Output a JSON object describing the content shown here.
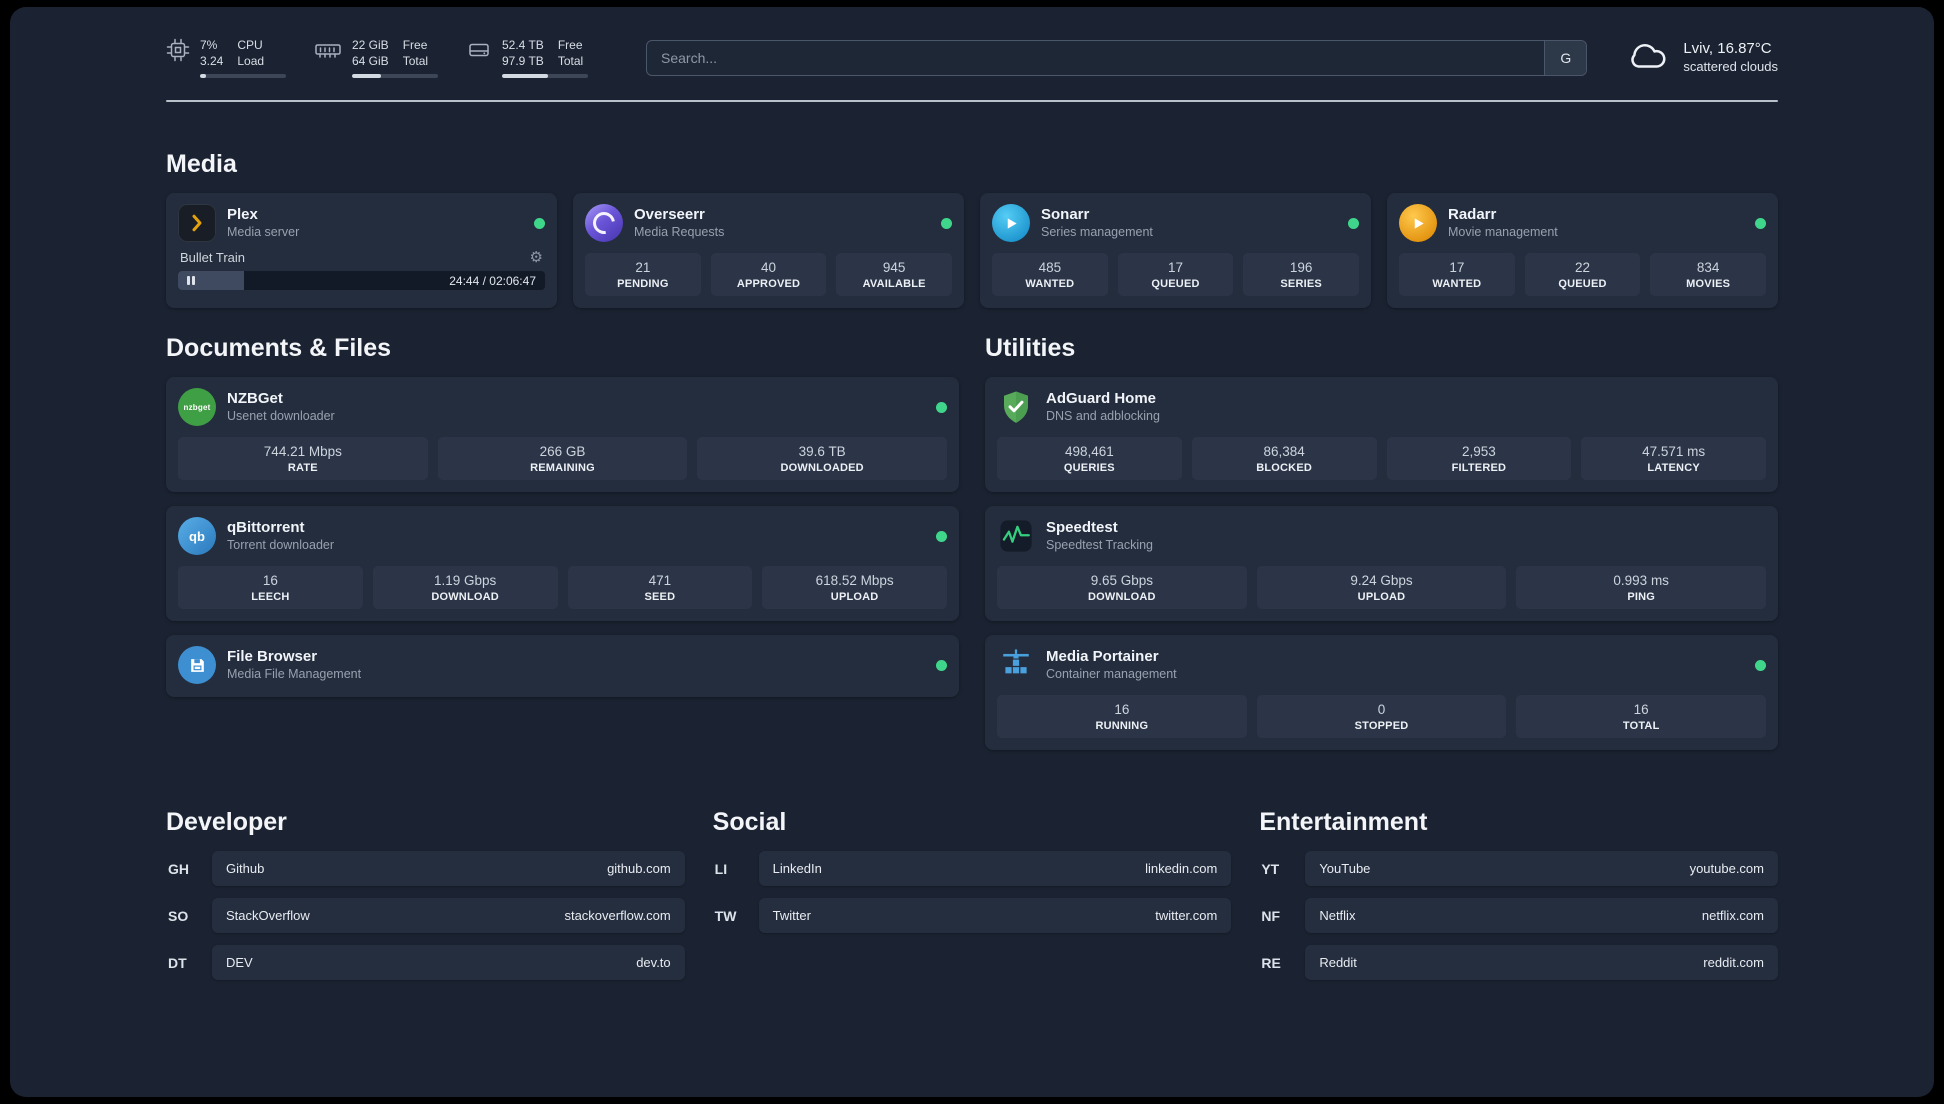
{
  "colors": {
    "background": "#1b2332",
    "card": "#242d3d",
    "tile": "#2b3547",
    "status_online": "#3fd68c",
    "accent_green": "#35d07f",
    "plex_amber": "#e5a00d"
  },
  "icons": {
    "gear": "⚙"
  },
  "topbar": {
    "cpu": {
      "top_value": "7%",
      "bottom_value": "3.24",
      "top_label": "CPU",
      "bottom_label": "Load",
      "progress": 7
    },
    "memory": {
      "top_value": "22 GiB",
      "bottom_value": "64 GiB",
      "top_label": "Free",
      "bottom_label": "Total",
      "progress": 34
    },
    "disk": {
      "top_value": "52.4 TB",
      "bottom_value": "97.9 TB",
      "top_label": "Free",
      "bottom_label": "Total",
      "progress": 54
    },
    "search": {
      "placeholder": "Search...",
      "button_label": "G"
    },
    "weather": {
      "line1": "Lviv, 16.87°C",
      "line2": "scattered clouds"
    }
  },
  "titles": {
    "media": "Media",
    "documents": "Documents & Files",
    "utilities": "Utilities"
  },
  "apps": {
    "plex": {
      "name": "Plex",
      "desc": "Media server",
      "player": {
        "title": "Bullet Train",
        "time": "24:44 / 02:06:47",
        "progress": 18
      }
    },
    "overseerr": {
      "name": "Overseerr",
      "desc": "Media Requests",
      "stats": [
        {
          "value": "21",
          "label": "PENDING"
        },
        {
          "value": "40",
          "label": "APPROVED"
        },
        {
          "value": "945",
          "label": "AVAILABLE"
        }
      ]
    },
    "sonarr": {
      "name": "Sonarr",
      "desc": "Series management",
      "stats": [
        {
          "value": "485",
          "label": "WANTED"
        },
        {
          "value": "17",
          "label": "QUEUED"
        },
        {
          "value": "196",
          "label": "SERIES"
        }
      ]
    },
    "radarr": {
      "name": "Radarr",
      "desc": "Movie management",
      "stats": [
        {
          "value": "17",
          "label": "WANTED"
        },
        {
          "value": "22",
          "label": "QUEUED"
        },
        {
          "value": "834",
          "label": "MOVIES"
        }
      ]
    },
    "nzbget": {
      "name": "NZBGet",
      "desc": "Usenet downloader",
      "icon_text": "nzbget",
      "stats": [
        {
          "value": "744.21 Mbps",
          "label": "RATE"
        },
        {
          "value": "266 GB",
          "label": "REMAINING"
        },
        {
          "value": "39.6 TB",
          "label": "DOWNLOADED"
        }
      ]
    },
    "qbittorrent": {
      "name": "qBittorrent",
      "desc": "Torrent downloader",
      "icon_text": "qb",
      "stats": [
        {
          "value": "16",
          "label": "LEECH"
        },
        {
          "value": "1.19 Gbps",
          "label": "DOWNLOAD"
        },
        {
          "value": "471",
          "label": "SEED"
        },
        {
          "value": "618.52 Mbps",
          "label": "UPLOAD"
        }
      ]
    },
    "filebrowser": {
      "name": "File Browser",
      "desc": "Media File Management"
    },
    "adguard": {
      "name": "AdGuard Home",
      "desc": "DNS and adblocking",
      "stats": [
        {
          "value": "498,461",
          "label": "QUERIES"
        },
        {
          "value": "86,384",
          "label": "BLOCKED"
        },
        {
          "value": "2,953",
          "label": "FILTERED"
        },
        {
          "value": "47.571 ms",
          "label": "LATENCY"
        }
      ]
    },
    "speedtest": {
      "name": "Speedtest",
      "desc": "Speedtest Tracking",
      "stats": [
        {
          "value": "9.65 Gbps",
          "label": "DOWNLOAD"
        },
        {
          "value": "9.24 Gbps",
          "label": "UPLOAD"
        },
        {
          "value": "0.993 ms",
          "label": "PING"
        }
      ]
    },
    "portainer": {
      "name": "Media Portainer",
      "desc": "Container management",
      "stats": [
        {
          "value": "16",
          "label": "RUNNING"
        },
        {
          "value": "0",
          "label": "STOPPED"
        },
        {
          "value": "16",
          "label": "TOTAL"
        }
      ]
    }
  },
  "bookmarks": {
    "developer": {
      "title": "Developer",
      "items": [
        {
          "abbr": "GH",
          "name": "Github",
          "url": "github.com"
        },
        {
          "abbr": "SO",
          "name": "StackOverflow",
          "url": "stackoverflow.com"
        },
        {
          "abbr": "DT",
          "name": "DEV",
          "url": "dev.to"
        }
      ]
    },
    "social": {
      "title": "Social",
      "items": [
        {
          "abbr": "LI",
          "name": "LinkedIn",
          "url": "linkedin.com"
        },
        {
          "abbr": "TW",
          "name": "Twitter",
          "url": "twitter.com"
        }
      ]
    },
    "entertainment": {
      "title": "Entertainment",
      "items": [
        {
          "abbr": "YT",
          "name": "YouTube",
          "url": "youtube.com"
        },
        {
          "abbr": "NF",
          "name": "Netflix",
          "url": "netflix.com"
        },
        {
          "abbr": "RE",
          "name": "Reddit",
          "url": "reddit.com"
        }
      ]
    }
  }
}
